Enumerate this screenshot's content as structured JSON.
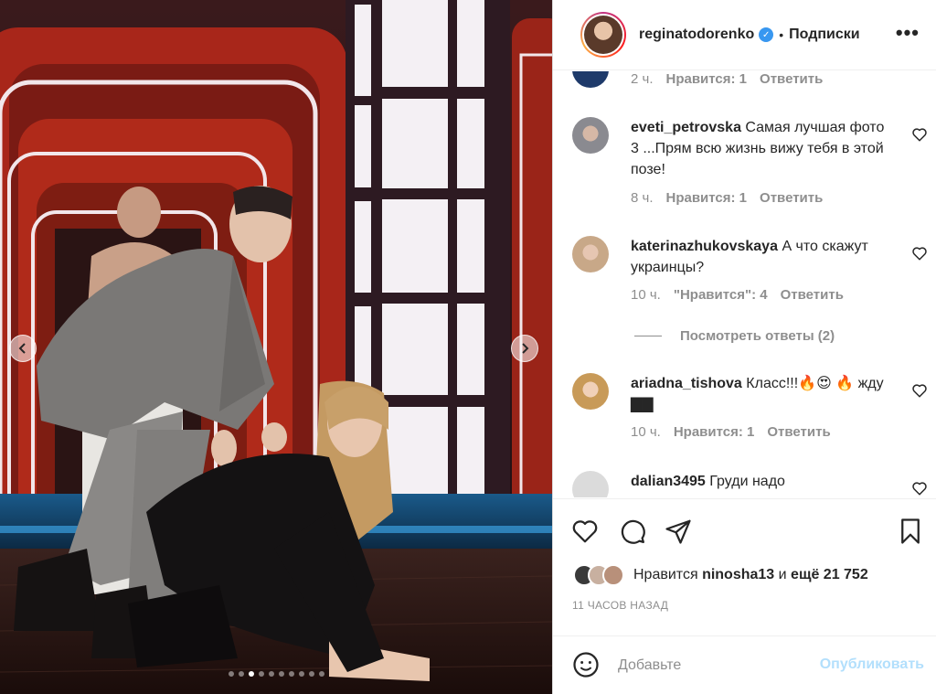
{
  "header": {
    "username": "reginatodorenko",
    "verified_icon": "verified-badge-icon",
    "separator": "•",
    "follow_label": "Подписки",
    "more_icon": "more-horizontal-icon"
  },
  "comments": [
    {
      "user": "",
      "text": "",
      "time": "2 ч.",
      "likes": "Нравится: 1",
      "reply": "Ответить"
    },
    {
      "user": "eveti_petrovska",
      "text": "Самая лучшая фото 3 ...Прям всю жизнь вижу тебя в этой позе!",
      "time": "8 ч.",
      "likes": "Нравится: 1",
      "reply": "Ответить"
    },
    {
      "user": "katerinazhukovskaya",
      "text": "А что скажут украинцы?",
      "time": "10 ч.",
      "likes": "\"Нравится\": 4",
      "reply": "Ответить"
    },
    {
      "user": "ariadna_tishova",
      "text": "Класс!!!🔥😍 🔥 жду ▇▇",
      "time": "10 ч.",
      "likes": "Нравится: 1",
      "reply": "Ответить"
    },
    {
      "user": "dalian3495",
      "text": "Груди надо",
      "time": "",
      "likes": "",
      "reply": ""
    }
  ],
  "view_replies": "Посмотреть ответы (2)",
  "likes": {
    "prefix": "Нравится",
    "user": "ninosha13",
    "middle": "и",
    "rest": "ещё 21 752"
  },
  "time_ago": "11 ЧАСОВ НАЗАД",
  "add_comment": {
    "placeholder": "Добавьте",
    "publish": "Опубликовать"
  },
  "carousel": {
    "total": 10,
    "active_index": 3
  },
  "colors": {
    "accent": "#3897f0",
    "publish_disabled": "#b2dffc",
    "muted": "#8e8e8e"
  }
}
